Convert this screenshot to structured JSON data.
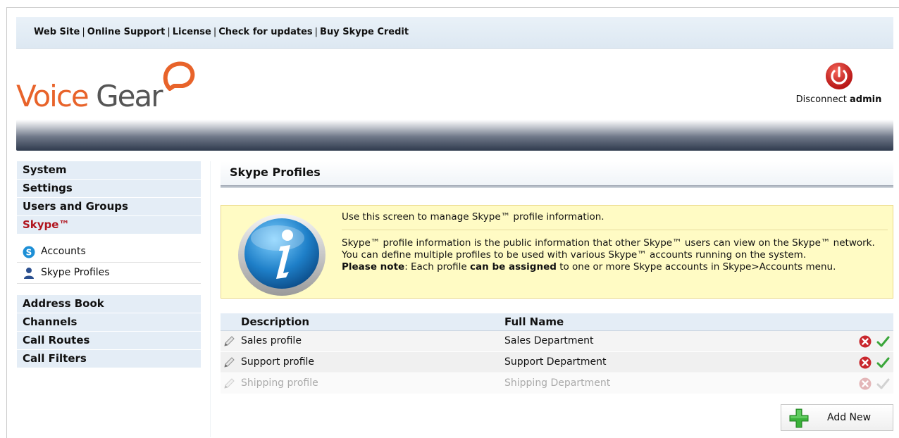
{
  "top_links": [
    "Web Site",
    "Online Support",
    "License",
    "Check for updates",
    "Buy Skype Credit"
  ],
  "logo": {
    "word1": "Voice",
    "word2": "Gear"
  },
  "disconnect": {
    "label": "Disconnect",
    "user": "admin"
  },
  "nav": {
    "items_top": [
      "System",
      "Settings",
      "Users and Groups",
      "Skype™"
    ],
    "active": "Skype™",
    "sub_items": [
      {
        "label": "Accounts",
        "icon": "skype-icon"
      },
      {
        "label": "Skype Profiles",
        "icon": "user-icon"
      }
    ],
    "items_bottom": [
      "Address Book",
      "Channels",
      "Call Routes",
      "Call Filters"
    ]
  },
  "page": {
    "title": "Skype Profiles"
  },
  "info": {
    "line1": "Use this screen to manage Skype™ profile information.",
    "para1": "Skype™ profile information is the public information that other Skype™ users can view on the Skype™ network.",
    "para2": "You can define multiple profiles to be used with various Skype™ accounts running on the system.",
    "note_label": "Please note",
    "note_text1": ": Each profile ",
    "note_bold": "can be assigned",
    "note_text2": " to one or more Skype accounts in Skype>Accounts menu."
  },
  "table": {
    "headers": {
      "description": "Description",
      "full_name": "Full Name"
    },
    "rows": [
      {
        "description": "Sales profile",
        "full_name": "Sales Department",
        "enabled": true
      },
      {
        "description": "Support profile",
        "full_name": "Support Department",
        "enabled": true
      },
      {
        "description": "Shipping profile",
        "full_name": "Shipping Department",
        "enabled": false
      }
    ]
  },
  "add_new": {
    "label": "Add New"
  },
  "colors": {
    "accent_red": "#b0141e",
    "logo_orange": "#e8632a",
    "nav_bg": "#e4edf6",
    "info_bg": "#fffbc4"
  }
}
